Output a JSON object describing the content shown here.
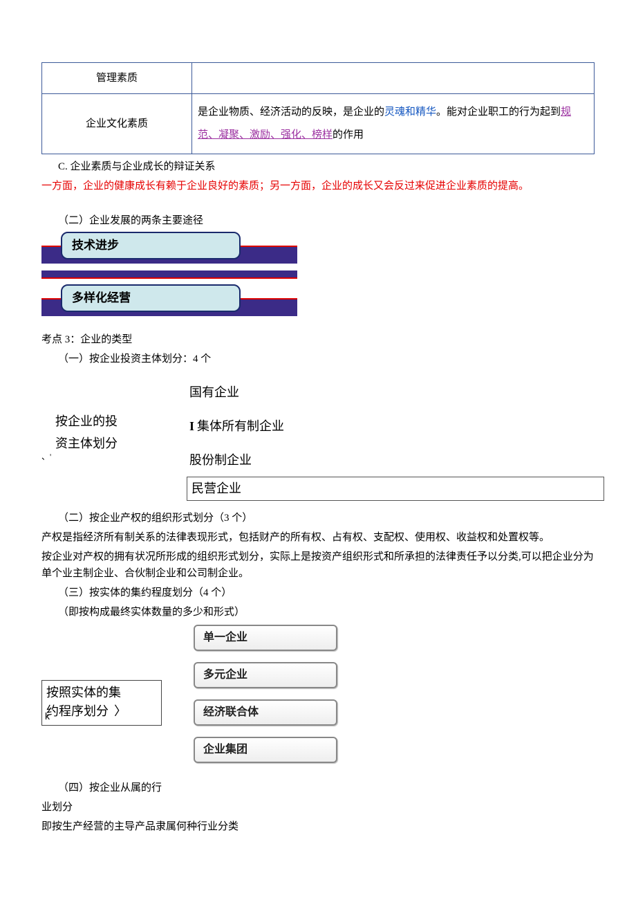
{
  "table": {
    "row1_label": "管理素质",
    "row1_desc": "",
    "row2_label": "企业文化素质",
    "row2_pre": "是企业物质、经济活动的反映，是企业的",
    "row2_link1": "灵魂和精华",
    "row2_mid": "。能对企业职工的行为起到",
    "row2_link2": "规范、凝聚、激励、强化、榜样",
    "row2_post": "的作用"
  },
  "sectionC": "C. 企业素质与企业成长的辩证关系",
  "redline": "一方面，企业的健康成长有赖于企业良好的素质；另一方面，企业的成长又会反过来促进企业素质的提高。",
  "pathTitle": "（二）企业发展的两条主要途径",
  "path1": "技术进步",
  "path2": "多样化经营",
  "kd3": "考点 3：企业的类型",
  "sub1": "（一）按企业投资主体划分：4 个",
  "invest": {
    "left1": "按企业的投",
    "left2": "资主体划分",
    "i1": "国有企业",
    "i2_pre": "I",
    "i2": "集体所有制企业",
    "i3": "股份制企业",
    "i4": "民营企业",
    "mark": "、'"
  },
  "sub2": "（二）按企业产权的组织形式划分（3 个）",
  "para2a": "产权是指经济所有制关系的法律表现形式，包括财产的所有权、占有权、支配权、使用权、收益权和处置权等。",
  "para2b": "按企业对产权的拥有状况所形成的组织形式划分，实际上是按资产组织形式和所承担的法律责任予以分类,可以把企业分为单个业主制企业、合伙制企业和公司制企业。",
  "sub3": "（三）按实体的集约程度划分（4 个）",
  "sub3note": "（即按构成最终实体数量的多少和形式）",
  "agg": {
    "left1": "按照实体的集",
    "left2": "约程序划分",
    "k": "k",
    "a1": "单一企业",
    "a2": "多元企业",
    "a3": "经济联合体",
    "a4": "企业集团"
  },
  "sub4a": "（四）按企业从属的行",
  "sub4b": "业划分",
  "para4": "即按生产经营的主导产品隶属何种行业分类"
}
